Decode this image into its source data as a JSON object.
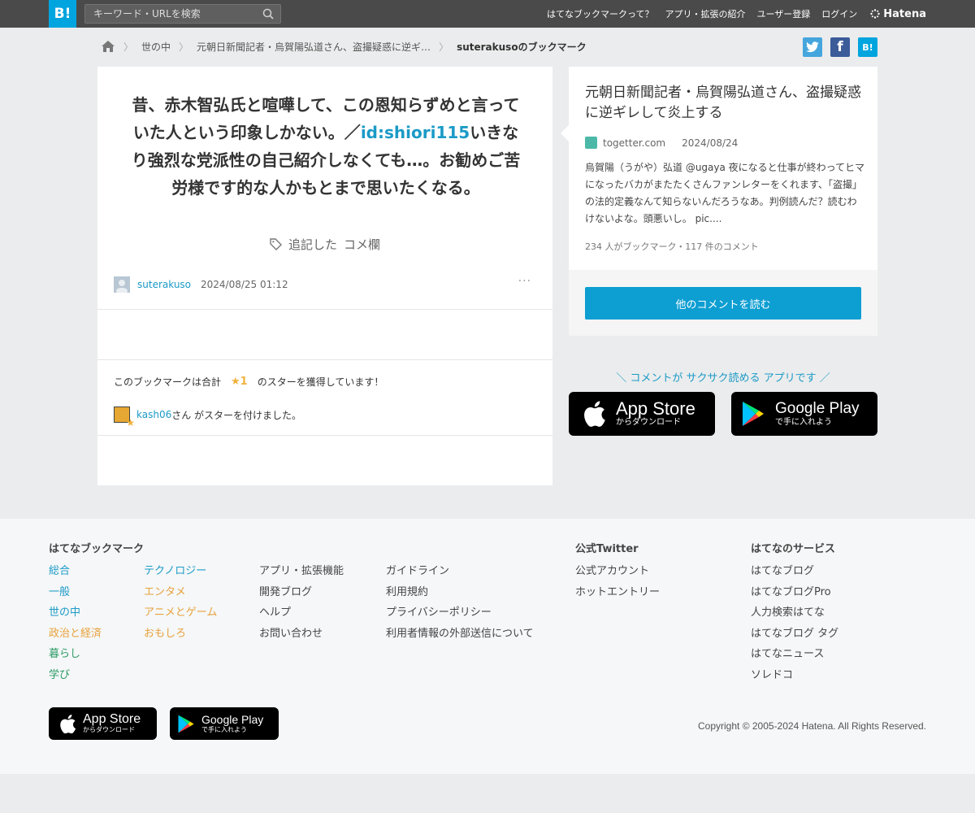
{
  "header": {
    "logo": "B!",
    "search_placeholder": "キーワード・URLを検索",
    "nav": [
      "はてなブックマークって？",
      "アプリ・拡張の紹介",
      "ユーザー登録",
      "ログイン"
    ],
    "brand": "Hatena"
  },
  "breadcrumb": {
    "items": [
      "世の中",
      "元朝日新聞記者・烏賀陽弘道さん、盗撮疑惑に逆ギ…",
      "suterakusoのブックマーク"
    ]
  },
  "share": {
    "twitter": "t",
    "facebook": "f",
    "hatena": "B!"
  },
  "bookmark": {
    "comment_before": "昔、赤木智弘氏と喧嘩して、この恩知らずめと言っていた人という印象しかない。／",
    "comment_id": "id:shiori115",
    "comment_after": "いきなり強烈な党派性の自己紹介しなくても…。お勧めご苦労様です的な人かもとまで思いたくなる。",
    "tags": [
      "追記した",
      "コメ欄"
    ],
    "user": "suterakuso",
    "date": "2024/08/25 01:12",
    "more": "···"
  },
  "stars": {
    "line_before": "このブックマークは合計",
    "count": "★1",
    "line_after": "のスターを獲得しています！",
    "giver": "kash06",
    "giver_suffix": "さん がスターを付けました。"
  },
  "entry": {
    "title": "元朝日新聞記者・烏賀陽弘道さん、盗撮疑惑に逆ギレして炎上する",
    "domain": "togetter.com",
    "date": "2024/08/24",
    "description": "烏賀陽（うがや）弘道 @ugaya 夜になると仕事が終わってヒマになったバカがまたたくさんファンレターをくれます、「盗撮」の法的定義なんて知らないんだろうなあ。判例読んだ？読むわけないよな。頭悪いし。 pic....",
    "count": "234 人がブックマーク・117 件のコメント",
    "read_button": "他のコメントを読む"
  },
  "app_promo": {
    "text": "＼ コメントが サクサク読める アプリです ／",
    "appstore_main": "App Store",
    "appstore_sub": "からダウンロード",
    "googleplay_main": "Google Play",
    "googleplay_sub": "で手に入れよう"
  },
  "footer": {
    "col1_title": "はてなブックマーク",
    "categories_a": [
      "総合",
      "一般",
      "世の中",
      "政治と経済",
      "暮らし",
      "学び"
    ],
    "categories_b": [
      "テクノロジー",
      "エンタメ",
      "アニメとゲーム",
      "おもしろ"
    ],
    "links_a": [
      "アプリ・拡張機能",
      "開発ブログ",
      "ヘルプ",
      "お問い合わせ"
    ],
    "links_b": [
      "ガイドライン",
      "利用規約",
      "プライバシーポリシー",
      "利用者情報の外部送信について"
    ],
    "twitter_title": "公式Twitter",
    "twitter_links": [
      "公式アカウント",
      "ホットエントリー"
    ],
    "services_title": "はてなのサービス",
    "services": [
      "はてなブログ",
      "はてなブログPro",
      "人力検索はてな",
      "はてなブログ タグ",
      "はてなニュース",
      "ソレドコ"
    ],
    "copyright": "Copyright © 2005-2024 Hatena. All Rights Reserved."
  },
  "colors": {
    "accent": "#00a4de",
    "link": "#1b9ac7",
    "button": "#0d9ed2",
    "star": "#f1b13d"
  }
}
